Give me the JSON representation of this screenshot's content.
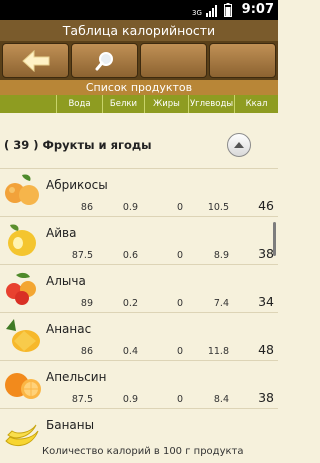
{
  "status": {
    "time": "9:07",
    "network": "3G"
  },
  "title": "Таблица калорийности",
  "toolbar": {
    "buttons": [
      {
        "icon": "back-arrow-icon"
      },
      {
        "icon": "search-icon"
      },
      {
        "icon": ""
      },
      {
        "icon": ""
      }
    ]
  },
  "section": "Список продуктов",
  "columns": [
    "Вода",
    "Белки",
    "Жиры",
    "Углеводы",
    "Ккал"
  ],
  "category": {
    "label": "( 39 ) Фрукты и ягоды"
  },
  "items": [
    {
      "name": "Абрикосы",
      "water": "86",
      "protein": "0.9",
      "fat": "0",
      "carbs": "10.5",
      "kcal": "46"
    },
    {
      "name": "Айва",
      "water": "87.5",
      "protein": "0.6",
      "fat": "0",
      "carbs": "8.9",
      "kcal": "38"
    },
    {
      "name": "Алыча",
      "water": "89",
      "protein": "0.2",
      "fat": "0",
      "carbs": "7.4",
      "kcal": "34"
    },
    {
      "name": "Ананас",
      "water": "86",
      "protein": "0.4",
      "fat": "0",
      "carbs": "11.8",
      "kcal": "48"
    },
    {
      "name": "Апельсин",
      "water": "87.5",
      "protein": "0.9",
      "fat": "0",
      "carbs": "8.4",
      "kcal": "38"
    },
    {
      "name": "Бананы",
      "water": "",
      "protein": "",
      "fat": "",
      "carbs": "",
      "kcal": ""
    }
  ],
  "tooltip": "Количество калорий в 100 г продукта",
  "colors": {
    "title": "#7a5b2c",
    "toolbar": "#5a4019",
    "section": "#b88637",
    "columns": "#8e9c21",
    "background": "#f6f1dc"
  }
}
